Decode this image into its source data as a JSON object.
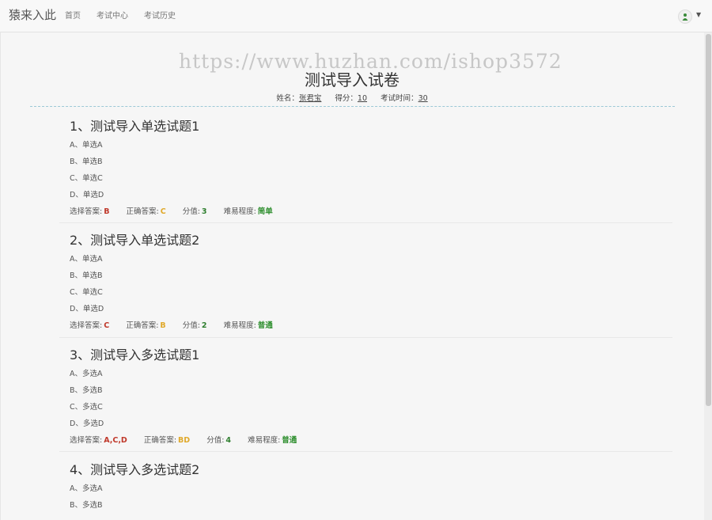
{
  "nav": {
    "brand": "猿来入此",
    "links": [
      "首页",
      "考试中心",
      "考试历史"
    ]
  },
  "watermark": "https://www.huzhan.com/ishop3572",
  "paper": {
    "title": "测试导入试卷",
    "name_label": "姓名：",
    "name": "张君宝",
    "score_label": "得分：",
    "score": "10",
    "time_label": "考试时间：",
    "time": "30"
  },
  "labels": {
    "selected": "选择答案:",
    "correct": "正确答案:",
    "points": "分值:",
    "difficulty": "难易程度:"
  },
  "questions": [
    {
      "title": "1、测试导入单选试题1",
      "options": [
        "A、单选A",
        "B、单选B",
        "C、单选C",
        "D、单选D"
      ],
      "selected": "B",
      "correct": "C",
      "points": "3",
      "difficulty": "简单"
    },
    {
      "title": "2、测试导入单选试题2",
      "options": [
        "A、单选A",
        "B、单选B",
        "C、单选C",
        "D、单选D"
      ],
      "selected": "C",
      "correct": "B",
      "points": "2",
      "difficulty": "普通"
    },
    {
      "title": "3、测试导入多选试题1",
      "options": [
        "A、多选A",
        "B、多选B",
        "C、多选C",
        "D、多选D"
      ],
      "selected": "A,C,D",
      "correct": "BD",
      "points": "4",
      "difficulty": "普通"
    },
    {
      "title": "4、测试导入多选试题2",
      "options": [
        "A、多选A",
        "B、多选B"
      ]
    }
  ],
  "colors": {
    "selected": "#c0392b",
    "correct": "#e0a92b",
    "points": "#2f7f2f",
    "difficulty": "#2f8f2f"
  },
  "icons": {
    "avatar": "user-avatar-icon",
    "caret": "caret-down-icon"
  }
}
